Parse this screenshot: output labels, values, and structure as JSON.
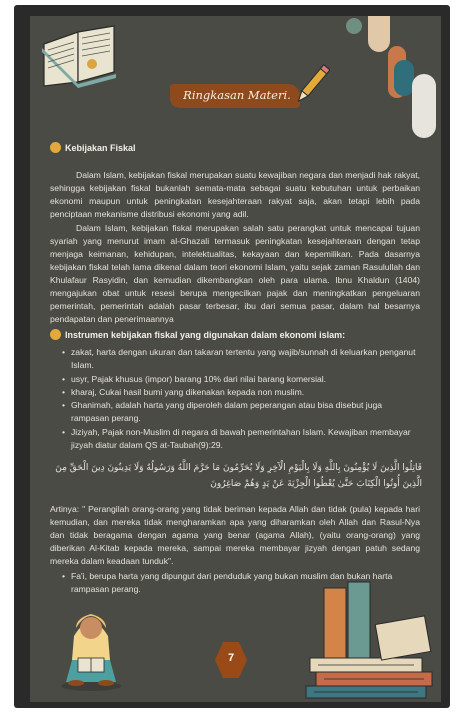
{
  "banner": {
    "title": "Ringkasan Materi."
  },
  "section1": {
    "heading": "Kebijakan Fiskal",
    "paragraphs": [
      "Dalam Islam, kebijakan fiskal merupakan suatu kewajiban negara dan menjadi hak rakyat, sehingga kebijakan fiskal bukanlah semata-mata sebagai suatu kebutuhan untuk perbaikan ekonomi maupun untuk peningkatan kesejahteraan rakyat saja, akan tetapi lebih pada penciptaan mekanisme distribusi ekonomi yang adil.",
      "Dalam Islam, kebijakan fiskal merupakan salah satu perangkat untuk mencapai tujuan syariah yang menurut imam al-Ghazali termasuk peningkatan kesejahteraan dengan tetap menjaga keimanan, kehidupan, intelektualitas, kekayaan dan kepemilikan. Pada dasarnya kebijakan fiskal telah lama dikenal dalam teori ekonomi Islam, yaitu sejak zaman Rasulullah dan Khulafaur Rasyidin, dan kemudian dikembangkan oleh para ulama. Ibnu Khaldun (1404) mengajukan obat untuk resesi berupa mengecilkan pajak dan meningkatkan pengeluaran pemerintah, pemerintah adalah pasar terbesar, ibu dari semua pasar, dalam hal besarnya pendapatan dan penerimaannya"
    ]
  },
  "section2": {
    "heading": "Instrumen kebijakan fiskal yang digunakan dalam ekonomi islam:",
    "bullets": [
      "zakat, harta dengan ukuran dan takaran tertentu yang wajib/sunnah di keluarkan penganut Islam.",
      "usyr, Pajak khusus (impor) barang 10% dari nilai barang komersial.",
      "kharaj, Cukai hasil bumi yang dikenakan kepada non muslim.",
      "Ghanimah, adalah harta yang diperoleh dalam peperangan atau bisa disebut juga rampasan perang.",
      "Jiziyah, Pajak non-Muslim di negara di bawah pemerintahan Islam. Kewajiban membayar jizyah diatur dalam QS at-Taubah(9):29."
    ],
    "arabic": "قَاتِلُوا الَّذِينَ لَا يُؤْمِنُونَ بِاللَّهِ وَلَا بِالْيَوْمِ الْآخِرِ وَلَا يُحَرِّمُونَ مَا حَرَّمَ اللَّهُ وَرَسُولُهُ وَلَا يَدِينُونَ دِينَ الْحَقِّ مِنَ الَّذِينَ أُوتُوا الْكِتَابَ حَتَّىٰ يُعْطُوا الْجِزْيَةَ عَنْ يَدٍ وَهُمْ صَاغِرُونَ",
    "translation": "Artinya: \" Perangilah orang-orang yang tidak beriman kepada Allah dan tidak (pula) kepada hari kemudian, dan mereka tidak mengharamkan apa yang diharamkan oleh Allah dan Rasul-Nya dan tidak beragama dengan agama yang benar (agama Allah), (yaitu orang-orang) yang diberikan Al-Kitab kepada mereka, sampai mereka membayar jizyah dengan patuh sedang mereka dalam keadaan tunduk\".",
    "last_bullet": "Fa'i, berupa harta yang dipungut dari penduduk yang bukan muslim dan bukan harta rampasan perang."
  },
  "page_number": "7",
  "colors": {
    "page_bg": "#4b4b45",
    "banner": "#8e4a1c",
    "accent": "#e3a93a",
    "page_badge": "#9a4a17"
  }
}
